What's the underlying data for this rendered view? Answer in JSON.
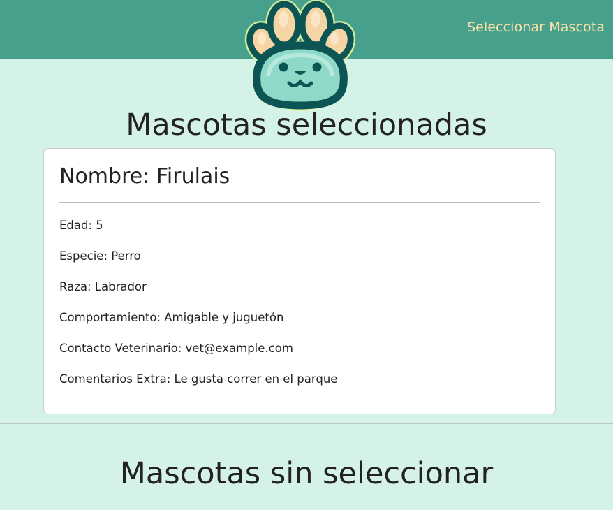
{
  "navbar": {
    "link_label": "Seleccionar Mascota"
  },
  "logo": {
    "icon": "paw-icon",
    "colors": {
      "outline": "#0c5554",
      "pad_fill": "#8fd9c8",
      "toe_fill": "#f6d5a5",
      "glow": "#e9f99e"
    }
  },
  "sections": {
    "selected_title": "Mascotas seleccionadas",
    "unselected_title": "Mascotas sin seleccionar"
  },
  "pet_card": {
    "name": "Nombre: Firulais",
    "fields": [
      "Edad: 5",
      "Especie: Perro",
      "Raza: Labrador",
      "Comportamiento: Amigable y juguetón",
      "Contacto Veterinario: vet@example.com",
      "Comentarios Extra: Le gusta correr en el parque"
    ]
  },
  "colors": {
    "navbar": "#46a08c",
    "background": "#d4f3e6",
    "nav_link": "#ffe2a8"
  }
}
